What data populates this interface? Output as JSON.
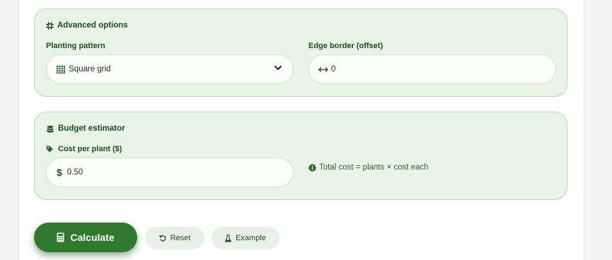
{
  "advanced": {
    "title": "Advanced options",
    "icon": "chip-icon",
    "pattern": {
      "label": "Planting pattern",
      "value": "Square grid",
      "icon": "grid-icon"
    },
    "border": {
      "label": "Edge border (offset)",
      "value": "0",
      "icon": "horizontal-arrows-icon"
    }
  },
  "budget": {
    "title": "Budget estimator",
    "icon": "coins-icon",
    "cost": {
      "label": "Cost per plant ($)",
      "value": "0.50",
      "icon": "tag-icon",
      "prefix_icon": "dollar-icon"
    },
    "note": "Total cost = plants × cost each"
  },
  "actions": {
    "calculate": "Calculate",
    "reset": "Reset",
    "example": "Example"
  },
  "colors": {
    "accent": "#2f7a2f",
    "panel_bg": "#e9f3e8",
    "panel_border": "#b9d8b6",
    "text_dark": "#1e4d1e"
  }
}
